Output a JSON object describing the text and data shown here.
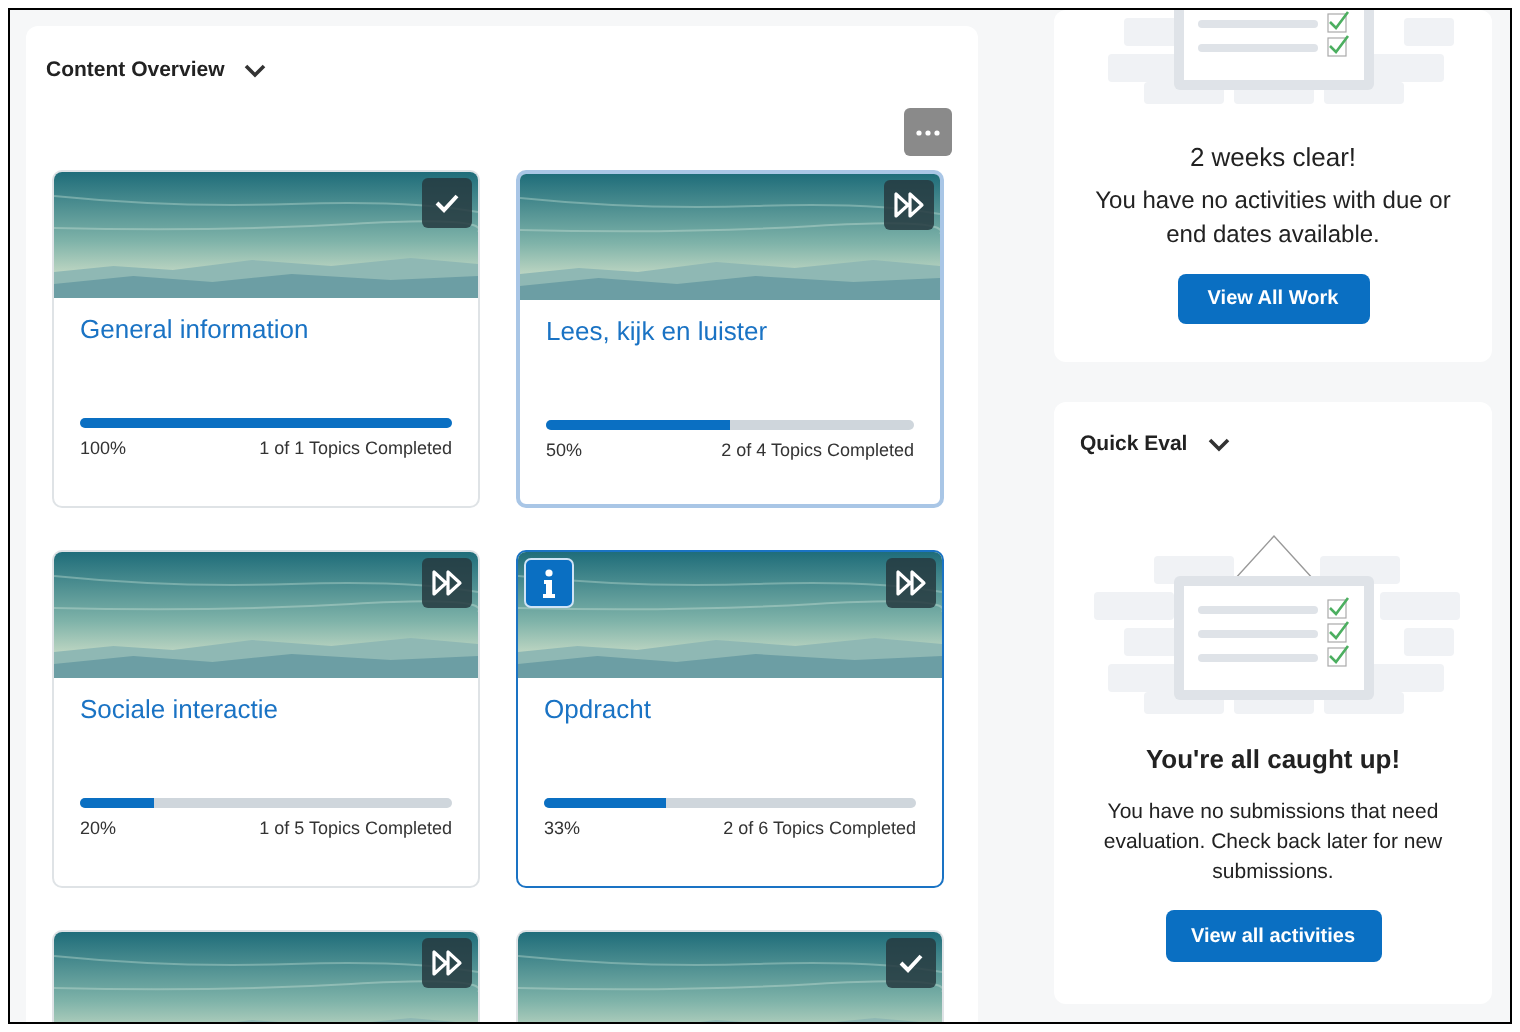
{
  "content_overview": {
    "title": "Content Overview",
    "tiles": [
      {
        "title": "General information",
        "kind": "complete",
        "hovered": false,
        "focused": false,
        "info_badge": false,
        "level": 1,
        "percent": "100%",
        "topics": "1 of 1 Topics Completed"
      },
      {
        "title": "Lees, kijk en luister",
        "kind": "in-progress",
        "hovered": true,
        "focused": false,
        "info_badge": false,
        "level": 0.5,
        "percent": "50%",
        "topics": "2 of 4 Topics Completed"
      },
      {
        "title": "Sociale interactie",
        "kind": "in-progress",
        "hovered": false,
        "focused": false,
        "info_badge": false,
        "level": 0.2,
        "percent": "20%",
        "topics": "1 of 5 Topics Completed"
      },
      {
        "title": "Opdracht",
        "kind": "in-progress",
        "hovered": false,
        "focused": true,
        "info_badge": true,
        "level": 0.33,
        "percent": "33%",
        "topics": "2 of 6 Topics Completed"
      },
      {
        "kind": "in-progress",
        "hovered": false,
        "focused": false,
        "info_badge": false
      },
      {
        "kind": "complete",
        "hovered": false,
        "focused": false,
        "info_badge": false
      }
    ]
  },
  "work_to_do": {
    "heading": "2 weeks clear!",
    "message": "You have no activities with due or end dates available.",
    "button": "View All Work"
  },
  "quick_eval": {
    "title": "Quick Eval",
    "heading": "You're all caught up!",
    "message": "You have no submissions that need evaluation. Check back later for new submissions.",
    "button": "View all activities"
  }
}
